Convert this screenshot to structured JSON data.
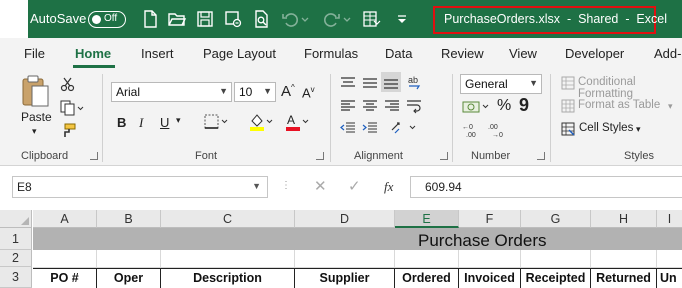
{
  "titlebar": {
    "autosave_label": "AutoSave",
    "autosave_state": "Off",
    "window_title": "PurchaseOrders.xlsx  -  Shared  -  Excel"
  },
  "tabs": [
    "File",
    "Home",
    "Insert",
    "Page Layout",
    "Formulas",
    "Data",
    "Review",
    "View",
    "Developer",
    "Add-"
  ],
  "active_tab": "Home",
  "ribbon": {
    "clipboard": {
      "paste_label": "Paste",
      "group_label": "Clipboard"
    },
    "font": {
      "font_name": "Arial",
      "font_size": "10",
      "group_label": "Font",
      "highlight_color": "#ffff00",
      "font_color": "#e81123"
    },
    "alignment": {
      "group_label": "Alignment"
    },
    "number": {
      "format": "General",
      "group_label": "Number"
    },
    "styles": {
      "conditional_formatting": "Conditional Formatting",
      "format_as_table": "Format as Table",
      "cell_styles": "Cell Styles",
      "group_label": "Styles"
    }
  },
  "formula_bar": {
    "name_box": "E8",
    "fx_label": "fx",
    "value": "609.94"
  },
  "sheet": {
    "columns": [
      "A",
      "B",
      "C",
      "D",
      "E",
      "F",
      "G",
      "H",
      "I"
    ],
    "selected_column": "E",
    "rows": [
      "1",
      "2",
      "3"
    ],
    "banner_title": "Purchase Orders",
    "header_row": [
      "PO #",
      "Oper",
      "Description",
      "Supplier",
      "Ordered",
      "Invoiced",
      "Receipted",
      "Returned",
      "Un"
    ]
  },
  "colors": {
    "excel_green": "#1e7145",
    "title_highlight": "#e01010"
  }
}
